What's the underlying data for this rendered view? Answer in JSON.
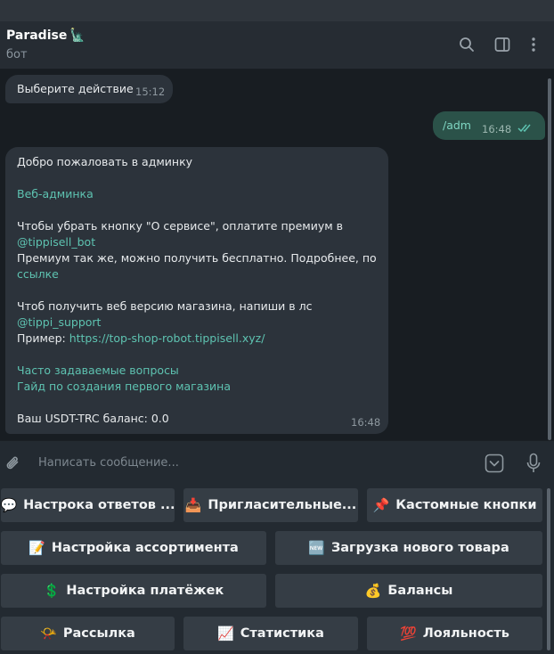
{
  "header": {
    "title": "Paradise",
    "title_emoji": "🗽",
    "subtitle": "бот"
  },
  "messages": {
    "m1": {
      "text": "Выберите действие",
      "time": "15:12"
    },
    "m2": {
      "text": "/adm",
      "time": "16:48"
    },
    "m3": {
      "line1": "Добро пожаловать в админку",
      "link_web_admin": "Веб-админка",
      "line3": "Чтобы убрать кнопку \"О сервисе\", оплатите премиум в",
      "link_bot": "@tippisell_bot",
      "line5": "Премиум так же, можно получить бесплатно. Подробнее, по",
      "link_here": "ссылке",
      "line7": "Чтоб получить веб версию магазина, напиши в лс",
      "link_support": "@tippi_support",
      "example_label": "Пример: ",
      "link_example": "https://top-shop-robot.tippisell.xyz/",
      "link_faq": "Часто задаваемые вопросы",
      "link_guide": "Гайд по создания первого магазина",
      "balance": "Ваш USDT-TRC баланс: 0.0",
      "time": "16:48"
    }
  },
  "composer": {
    "placeholder": "Написать сообщение..."
  },
  "keyboard": {
    "b1": {
      "emoji": "💬",
      "label": "Настрока ответов ..."
    },
    "b2": {
      "emoji": "📥",
      "label": "Пригласительные..."
    },
    "b3": {
      "emoji": "📌",
      "label": "Кастомные кнопки"
    },
    "b4": {
      "emoji": "📝",
      "label": "Настройка ассортимента"
    },
    "b5": {
      "emoji": "🆕",
      "label": "Загрузка нового товара"
    },
    "b6": {
      "emoji": "💲",
      "label": "Настройка платёжек"
    },
    "b7": {
      "emoji": "💰",
      "label": "Балансы"
    },
    "b8": {
      "emoji": "📯",
      "label": "Рассылка"
    },
    "b9": {
      "emoji": "📈",
      "label": "Статистика"
    },
    "b10": {
      "emoji": "💯",
      "label": "Лояльность"
    }
  },
  "colors": {
    "accent_link": "#5ec3b1",
    "outgoing_bubble": "#2b5249",
    "incoming_bubble": "#2c333b",
    "read_ticks": "#5ec3b1"
  },
  "icons": [
    "search-icon",
    "sidebar-toggle-icon",
    "more-vertical-icon",
    "attach-icon",
    "keyboard-toggle-icon",
    "microphone-icon",
    "double-check-icon"
  ]
}
